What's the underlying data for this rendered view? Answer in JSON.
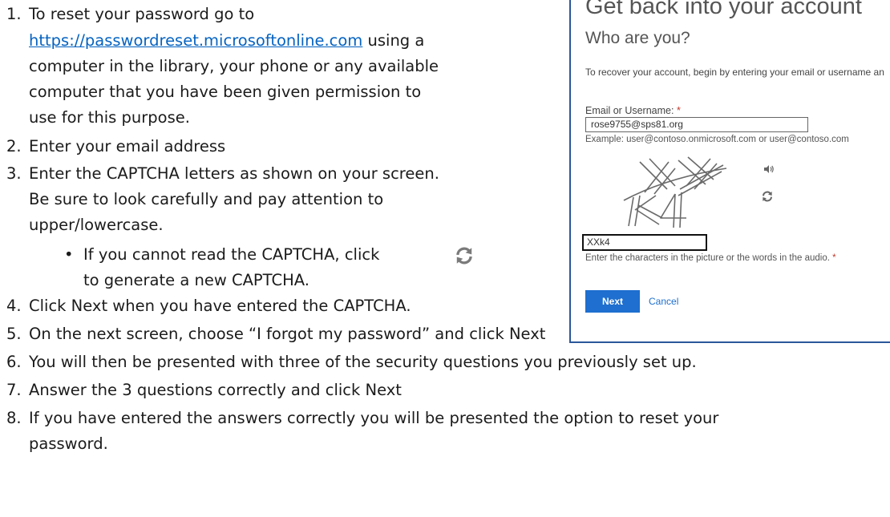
{
  "steps": [
    {
      "num": "1.",
      "line1": "To reset your password go to",
      "link": "https://passwordreset.microsoftonline.com",
      "line2_rest": " using a",
      "line3": "computer in the library, your phone or any available",
      "line4": "computer that you have been given permission to",
      "line5": "use for this purpose."
    },
    {
      "num": "2.",
      "text": "Enter your email address"
    },
    {
      "num": "3.",
      "line1": "Enter the CAPTCHA letters as shown on your screen.",
      "line2": "Be sure to look carefully and pay attention to",
      "line3": "upper/lowercase."
    },
    {
      "num": "4.",
      "text": "Click Next when you have entered the CAPTCHA."
    },
    {
      "num": "5.",
      "text": "On the next screen, choose “I forgot my password” and click Next"
    },
    {
      "num": "6.",
      "text": "You will then be presented with three of the security questions you previously set up."
    },
    {
      "num": "7.",
      "text": "Answer the 3 questions correctly and click Next"
    },
    {
      "num": "8.",
      "line1": "If you have entered the answers correctly you will be presented the option to reset your",
      "line2": "password."
    }
  ],
  "bullet": {
    "symbol": "•",
    "line1": "If you cannot read the CAPTCHA, click",
    "line2": "to generate a new CAPTCHA."
  },
  "screenshot": {
    "title": "Get back into your account",
    "subtitle": "Who are you?",
    "intro": "To recover your account, begin by entering your email or username an",
    "email_label": "Email or Username: ",
    "required_mark": "*",
    "email_value": "rose9755@sps81.org",
    "example": "Example: user@contoso.onmicrosoft.com or user@contoso.com",
    "captcha_value": "XXk4",
    "hint": "Enter the characters in the picture or the words in the audio. ",
    "next_label": "Next",
    "cancel_label": "Cancel"
  },
  "colors": {
    "link": "#0563c1",
    "accent": "#1e6fcf",
    "border": "#2b579a"
  },
  "icons": {
    "refresh": "refresh-icon",
    "speaker": "speaker-icon"
  }
}
